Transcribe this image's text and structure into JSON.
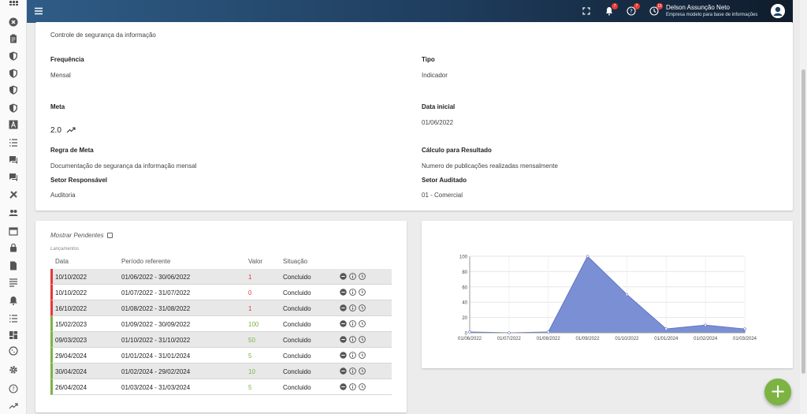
{
  "header": {
    "user_name": "Delson Assunção Neto",
    "company": "Empresa modelo para base de informações",
    "notifications_badge": "7",
    "help_badge": "7",
    "history_badge": "15"
  },
  "info": {
    "description_value": "Controle de segurança da informação",
    "frequencia_label": "Frequência",
    "frequencia_value": "Mensal",
    "tipo_label": "Tipo",
    "tipo_value": "Indicador",
    "meta_label": "Meta",
    "meta_value": "2.0",
    "data_inicial_label": "Data inicial",
    "data_inicial_value": "01/06/2022",
    "regra_label": "Regra de Meta",
    "regra_value": "Documentação de segurança da informação mensal",
    "calculo_label": "Cálculo para Resultado",
    "calculo_value": "Numero de publicações realizadas mensalmente",
    "setor_resp_label": "Setor Responsável",
    "setor_resp_value": "Auditoria",
    "setor_aud_label": "Setor Auditado",
    "setor_aud_value": "01 - Comercial"
  },
  "table": {
    "mostrar_pendentes": "Mostrar Pendentes",
    "lancamentos": "Lançamentos",
    "headers": [
      "Data",
      "Período referente",
      "Valor",
      "Situação"
    ],
    "rows": [
      {
        "data": "10/10/2022",
        "periodo": "01/06/2022 - 30/06/2022",
        "valor": "1",
        "situacao": "Concluido",
        "status": "red"
      },
      {
        "data": "10/10/2022",
        "periodo": "01/07/2022 - 31/07/2022",
        "valor": "0",
        "situacao": "Concluido",
        "status": "red"
      },
      {
        "data": "16/10/2022",
        "periodo": "01/08/2022 - 31/08/2022",
        "valor": "1",
        "situacao": "Concluido",
        "status": "red"
      },
      {
        "data": "15/02/2023",
        "periodo": "01/09/2022 - 30/09/2022",
        "valor": "100",
        "situacao": "Concluido",
        "status": "green"
      },
      {
        "data": "09/03/2023",
        "periodo": "01/10/2022 - 31/10/2022",
        "valor": "50",
        "situacao": "Concluido",
        "status": "green"
      },
      {
        "data": "29/04/2024",
        "periodo": "01/01/2024 - 31/01/2024",
        "valor": "5",
        "situacao": "Concluido",
        "status": "green"
      },
      {
        "data": "30/04/2024",
        "periodo": "01/02/2024 - 29/02/2024",
        "valor": "10",
        "situacao": "Concluido",
        "status": "green"
      },
      {
        "data": "26/04/2024",
        "periodo": "01/03/2024 - 31/03/2024",
        "valor": "5",
        "situacao": "Concluido",
        "status": "green"
      }
    ]
  },
  "chart_data": {
    "type": "area",
    "categories": [
      "01/06/2022",
      "01/07/2022",
      "01/08/2022",
      "01/09/2022",
      "01/10/2022",
      "01/01/2024",
      "01/02/2024",
      "01/03/2024"
    ],
    "values": [
      1,
      0,
      1,
      100,
      50,
      5,
      10,
      5
    ],
    "ylim": [
      0,
      100
    ],
    "yticks": [
      0,
      20,
      40,
      60,
      80,
      100
    ],
    "grid": true,
    "fill_color": "#7b8fd4",
    "line_color": "#6074c4"
  },
  "colors": {
    "accent_green": "#7cb342",
    "status_red": "#e53935"
  },
  "fab_label": "+"
}
